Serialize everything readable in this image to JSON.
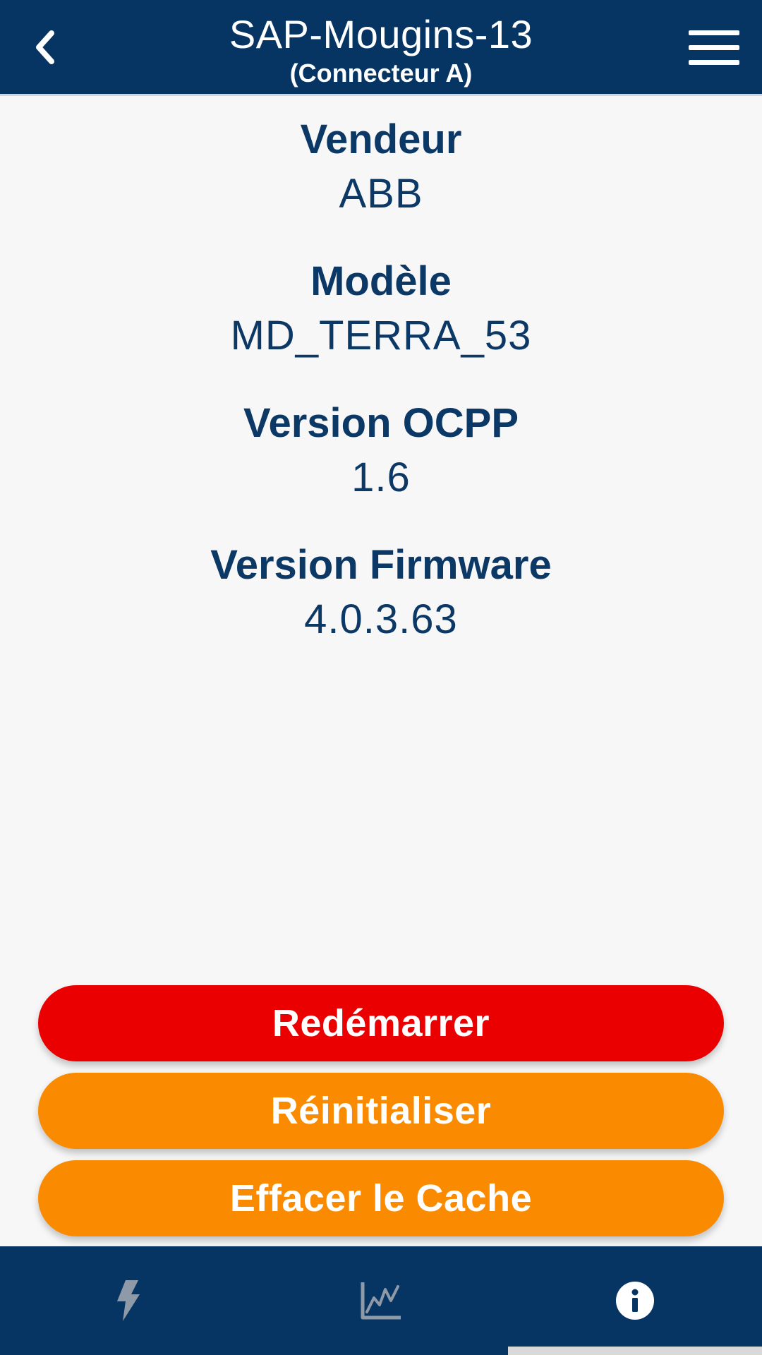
{
  "header": {
    "title": "SAP-Mougins-13",
    "subtitle": "(Connecteur A)",
    "back_icon": "chevron-left-icon",
    "menu_icon": "hamburger-menu-icon"
  },
  "info": [
    {
      "label": "Vendeur",
      "value": "ABB"
    },
    {
      "label": "Modèle",
      "value": "MD_TERRA_53"
    },
    {
      "label": "Version OCPP",
      "value": "1.6"
    },
    {
      "label": "Version Firmware",
      "value": "4.0.3.63"
    }
  ],
  "actions": {
    "restart_label": "Redémarrer",
    "reset_label": "Réinitialiser",
    "clear_cache_label": "Effacer le Cache"
  },
  "bottom_nav": {
    "items": [
      {
        "icon": "lightning-bolt-icon",
        "active": false
      },
      {
        "icon": "line-chart-icon",
        "active": false
      },
      {
        "icon": "info-icon",
        "active": true
      }
    ]
  },
  "colors": {
    "primary": "#073563",
    "text": "#0c3866",
    "danger": "#ea0000",
    "warning": "#fa8b00",
    "background": "#f7f7f8",
    "inactive_icon": "#8f9aa8"
  }
}
